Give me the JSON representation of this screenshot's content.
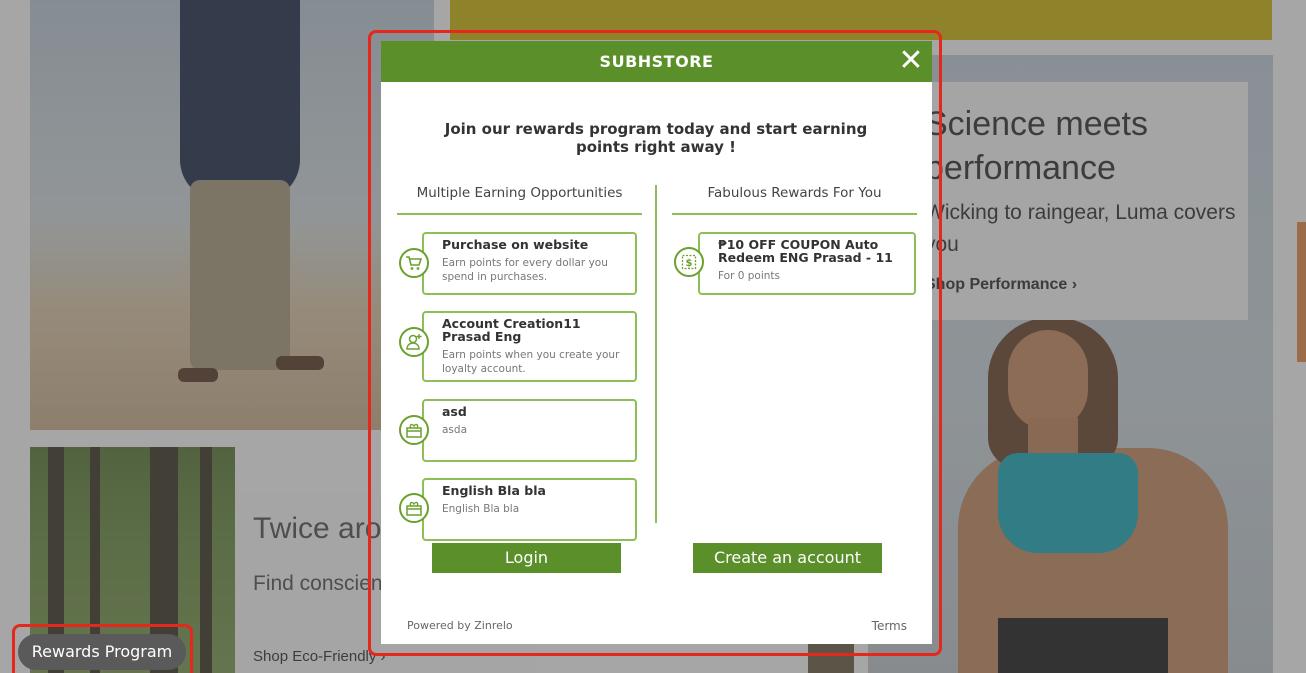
{
  "background": {
    "performance": {
      "title": "Science meets performance",
      "text": "Wicking to raingear, Luma covers you",
      "link": "Shop Performance ›"
    },
    "eco": {
      "title": "Twice around",
      "text": "Find conscientious collection",
      "link": "Shop Eco-Friendly ›"
    }
  },
  "rewards_tab": {
    "label": "Rewards Program"
  },
  "modal": {
    "title": "SUBHSTORE",
    "close_label": "✕",
    "intro": "Join our rewards program today and start earning points right away !",
    "earning": {
      "heading": "Multiple Earning Opportunities",
      "items": [
        {
          "title": "Purchase on website",
          "desc": "Earn points for every dollar you spend in purchases.",
          "icon": "cart-icon"
        },
        {
          "title": "Account Creation11 Prasad Eng",
          "desc": "Earn points when you create your loyalty account.",
          "icon": "add-user-icon"
        },
        {
          "title": "asd",
          "desc": "asda",
          "icon": "gift-icon"
        },
        {
          "title": "English Bla bla",
          "desc": "English Bla bla",
          "icon": "gift-icon"
        }
      ]
    },
    "rewards": {
      "heading": "Fabulous Rewards For You",
      "items": [
        {
          "title": "₱10 OFF COUPON Auto Redeem ENG Prasad - 11",
          "desc": "For 0 points",
          "icon": "coupon-icon"
        }
      ]
    },
    "login_label": "Login",
    "create_label": "Create an account",
    "powered_by": "Powered by Zinrelo",
    "terms": "Terms"
  },
  "colors": {
    "brand_green": "#5a8f2a",
    "card_border": "#8cbf55",
    "highlight": "#e4281c"
  }
}
